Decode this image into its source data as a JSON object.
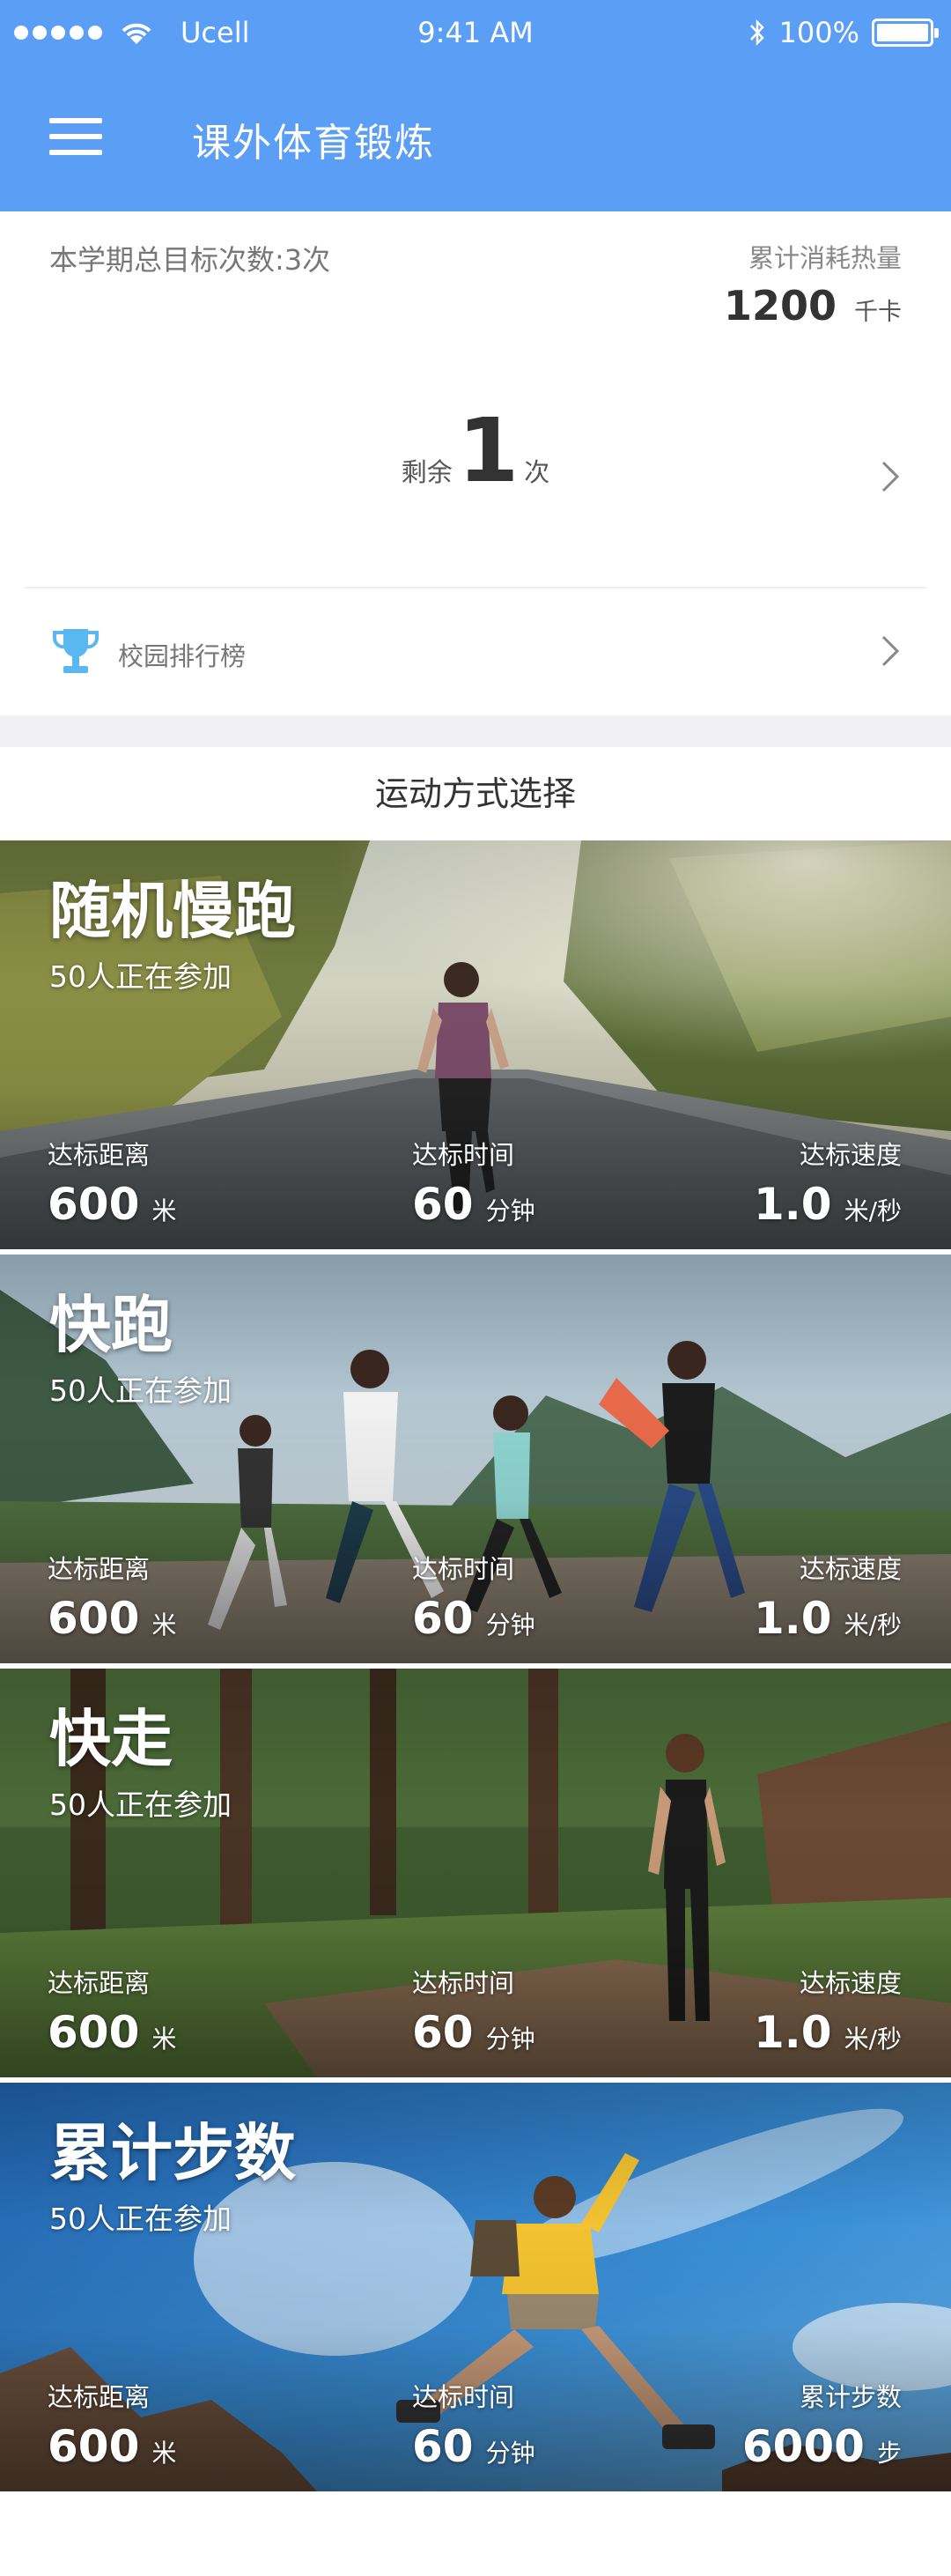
{
  "status_bar": {
    "carrier": "Ucell",
    "time": "9:41 AM",
    "battery": "100%"
  },
  "header": {
    "title": "课外体育锻炼"
  },
  "summary": {
    "goal_text": "本学期总目标次数:3次",
    "calorie_label": "累计消耗热量",
    "calorie_value": "1200",
    "calorie_unit": "千卡",
    "remaining_prefix": "剩余",
    "remaining_count": "1",
    "remaining_suffix": "次"
  },
  "ranking": {
    "label": "校园排行榜"
  },
  "section_title": "运动方式选择",
  "cards": [
    {
      "name": "随机慢跑",
      "count": "50人正在参加",
      "stats": [
        {
          "label": "达标距离",
          "value": "600",
          "unit": "米"
        },
        {
          "label": "达标时间",
          "value": "60",
          "unit": "分钟"
        },
        {
          "label": "达标速度",
          "value": "1.0",
          "unit": "米/秒"
        }
      ]
    },
    {
      "name": "快跑",
      "count": "50人正在参加",
      "stats": [
        {
          "label": "达标距离",
          "value": "600",
          "unit": "米"
        },
        {
          "label": "达标时间",
          "value": "60",
          "unit": "分钟"
        },
        {
          "label": "达标速度",
          "value": "1.0",
          "unit": "米/秒"
        }
      ]
    },
    {
      "name": "快走",
      "count": "50人正在参加",
      "stats": [
        {
          "label": "达标距离",
          "value": "600",
          "unit": "米"
        },
        {
          "label": "达标时间",
          "value": "60",
          "unit": "分钟"
        },
        {
          "label": "达标速度",
          "value": "1.0",
          "unit": "米/秒"
        }
      ]
    },
    {
      "name": "累计步数",
      "count": "50人正在参加",
      "stats": [
        {
          "label": "达标距离",
          "value": "600",
          "unit": "米"
        },
        {
          "label": "达标时间",
          "value": "60",
          "unit": "分钟"
        },
        {
          "label": "累计步数",
          "value": "6000",
          "unit": "步"
        }
      ]
    }
  ],
  "colors": {
    "header_bg": "#5b9ef5",
    "trophy": "#5ab8f0"
  },
  "icons": {
    "menu": "hamburger-icon",
    "wifi": "wifi-icon",
    "bluetooth": "bluetooth-icon",
    "battery": "battery-icon",
    "trophy": "trophy-icon",
    "arrow": "chevron-right-icon"
  }
}
